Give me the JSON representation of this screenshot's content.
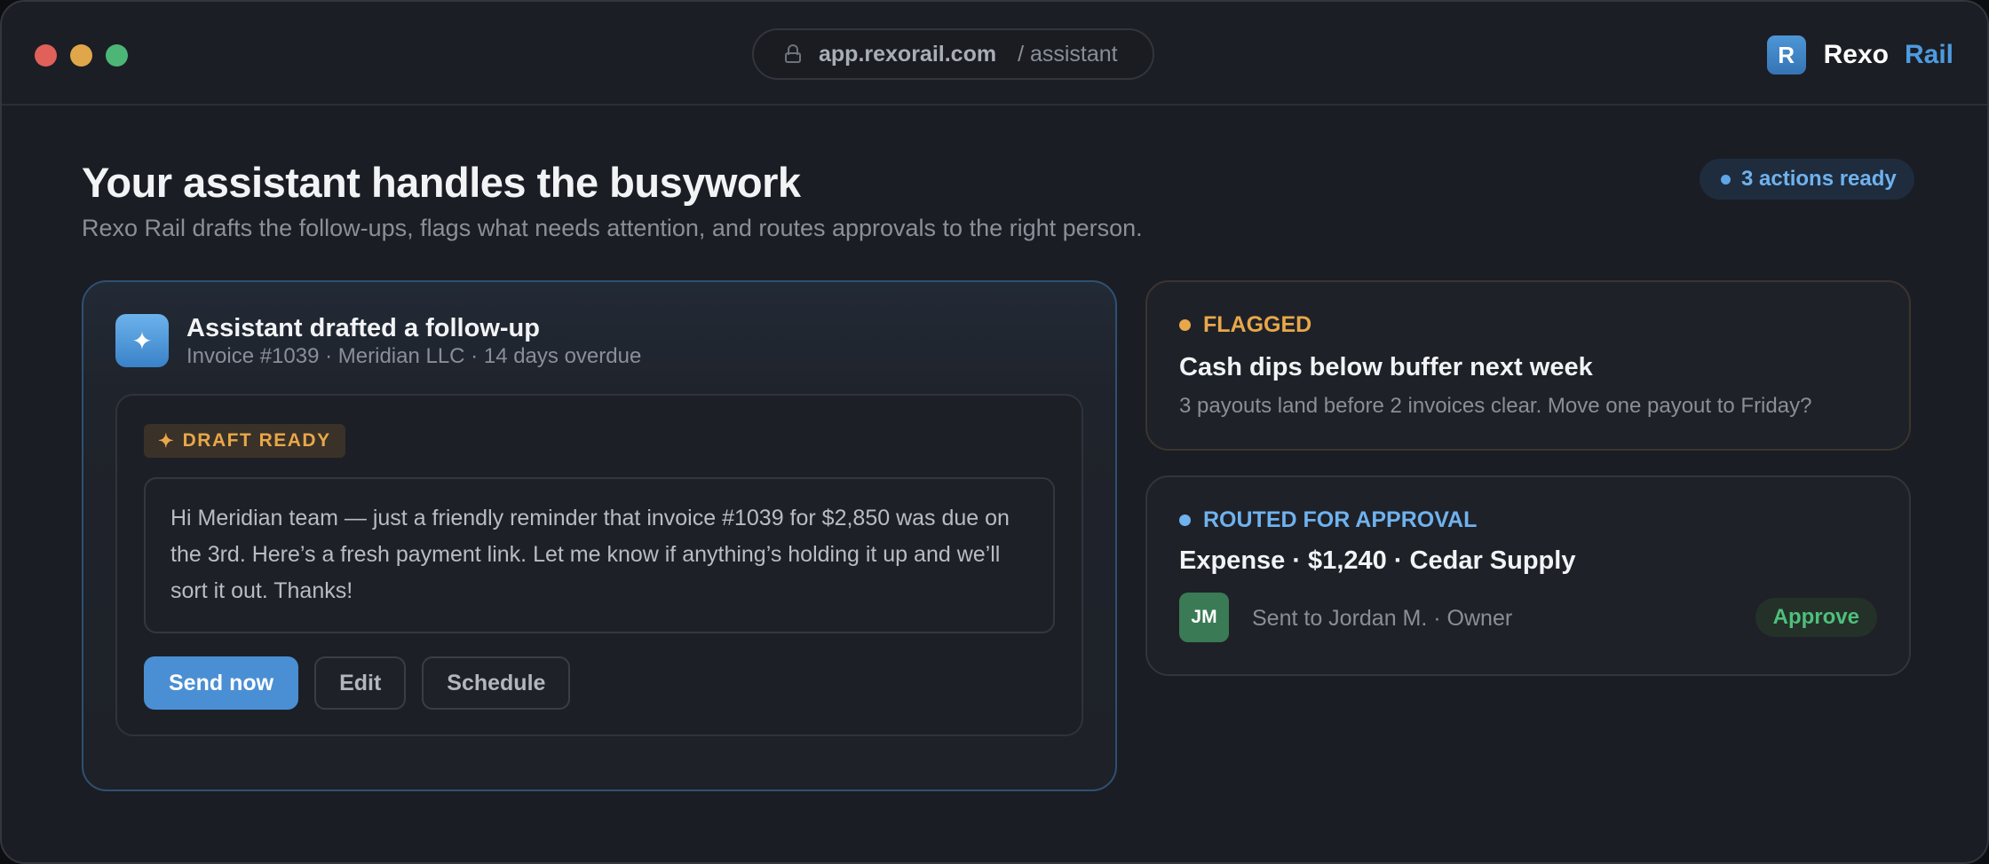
{
  "window": {
    "url_host": "app.rexorail.com",
    "url_path": "/ assistant"
  },
  "brand": {
    "logo_letter": "R",
    "name": "Rexo",
    "accent": "Rail"
  },
  "page": {
    "title": "Your assistant handles the busywork",
    "subtitle": "Rexo Rail drafts the follow-ups, flags what needs attention, and routes approvals to the right person.",
    "actions_badge": "3 actions ready"
  },
  "assistant_card": {
    "icon": "sparkle-icon",
    "title": "Assistant drafted a follow-up",
    "meta": "Invoice #1039 · Meridian LLC · 14 days overdue",
    "draft_tag_icon": "✦",
    "draft_tag": "DRAFT READY",
    "message": "Hi Meridian team — just a friendly reminder that invoice #1039 for $2,850 was due on the 3rd. Here’s a fresh payment link. Let me know if anything’s holding it up and we’ll sort it out. Thanks!",
    "buttons": {
      "send": "Send now",
      "edit": "Edit",
      "schedule": "Schedule"
    }
  },
  "flag_card": {
    "status": "FLAGGED",
    "title": "Cash dips below buffer next week",
    "description": "3 payouts land before 2 invoices clear. Move one payout to Friday?"
  },
  "approval_card": {
    "status": "ROUTED FOR APPROVAL",
    "title": "Expense · $1,240 · Cedar Supply",
    "avatar_initials": "JM",
    "sent_to": "Sent to Jordan M. · Owner",
    "approve_label": "Approve"
  },
  "colors": {
    "accent_blue": "#4a8fd4",
    "flag_amber": "#e8a84a",
    "approve_green": "#4fbf7c"
  }
}
